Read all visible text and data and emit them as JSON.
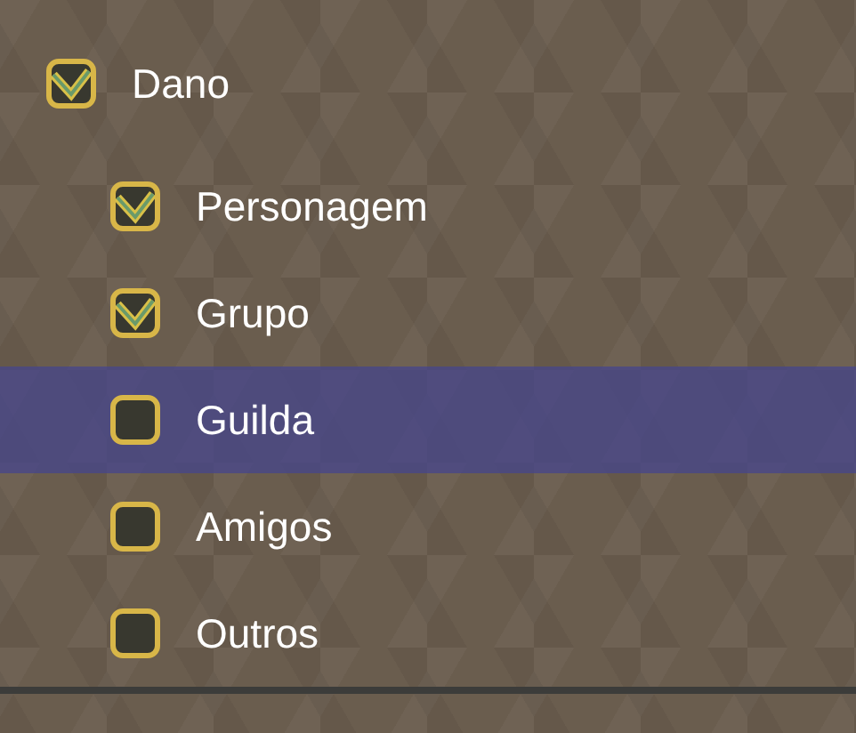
{
  "tree": [
    {
      "label": "Dano",
      "checked": true,
      "selected": false,
      "children": [
        {
          "label": "Personagem",
          "checked": true,
          "selected": false
        },
        {
          "label": "Grupo",
          "checked": true,
          "selected": false
        },
        {
          "label": "Guilda",
          "checked": false,
          "selected": true
        },
        {
          "label": "Amigos",
          "checked": false,
          "selected": false
        },
        {
          "label": "Outros",
          "checked": false,
          "selected": false
        }
      ]
    }
  ]
}
